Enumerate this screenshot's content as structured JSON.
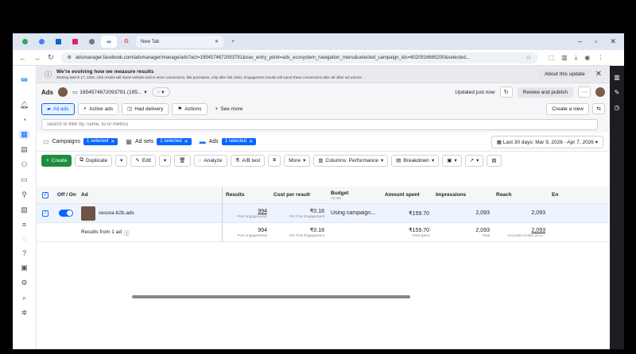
{
  "browser": {
    "new_tab_label": "New Tab",
    "url": "adsmanager.facebook.com/adsmanager/manage/ads?act=1954574672093791&nav_entry_point=ads_ecosystem_navigation_menu&selected_campaign_ids=6020916665200&selected..."
  },
  "banner": {
    "title": "We're evolving how we measure results",
    "body": "Starting March 17, 2026, click results will report website and in-store conversions, like purchases, only after link clicks. Engagement results will report these conversions after all other ad actions.",
    "about_label": "About this update"
  },
  "account": {
    "section": "Ads",
    "account_id": "1954574672093791 (195...",
    "updated": "Updated just now",
    "review_publish": "Review and publish",
    "more": "···"
  },
  "views": {
    "all_ads": "All ads",
    "active_ads": "Active ads",
    "had_delivery": "Had delivery",
    "actions": "Actions",
    "see_more": "See more",
    "create_view": "Create a view"
  },
  "search": {
    "placeholder": "Search to filter by: name, ID or metrics"
  },
  "levels": {
    "campaigns": "Campaigns",
    "campaigns_chip": "1 selected",
    "adsets": "Ad sets",
    "adsets_chip": "1 selected",
    "ads": "Ads",
    "ads_chip": "1 selected",
    "date_range": "Last 30 days: Mar 9, 2026 - Apr 7, 2026"
  },
  "toolbar": {
    "create": "Create",
    "duplicate": "Duplicate",
    "edit": "Edit",
    "analyze": "Analyze",
    "ab_test": "A/B test",
    "more": "More",
    "columns": "Columns: Performance",
    "breakdown": "Breakdown"
  },
  "table": {
    "headers": {
      "offon": "Off / On",
      "ad": "Ad",
      "results": "Results",
      "cost": "Cost per result",
      "budget": "Budget",
      "budget_sub": "Ad set",
      "amount": "Amount spent",
      "impressions": "Impressions",
      "reach": "Reach",
      "en": "En"
    },
    "row": {
      "name": "vesora-b2b.ads",
      "results": "994",
      "results_sub": "Post engagements",
      "cost": "₹0.16",
      "cost_sub": "Per Post Engagement",
      "budget": "Using campaign...",
      "amount": "₹159.70",
      "impressions": "2,093",
      "reach": "2,093"
    },
    "total": {
      "label": "Results from 1 ad",
      "results": "994",
      "results_sub": "Post engagements",
      "cost": "₹0.16",
      "cost_sub": "Per Post Engagement",
      "amount": "₹159.70",
      "amount_sub": "Total spent",
      "impressions": "2,093",
      "impressions_sub": "Total",
      "reach": "2,093",
      "reach_sub": "Accounts Center acco..."
    }
  }
}
